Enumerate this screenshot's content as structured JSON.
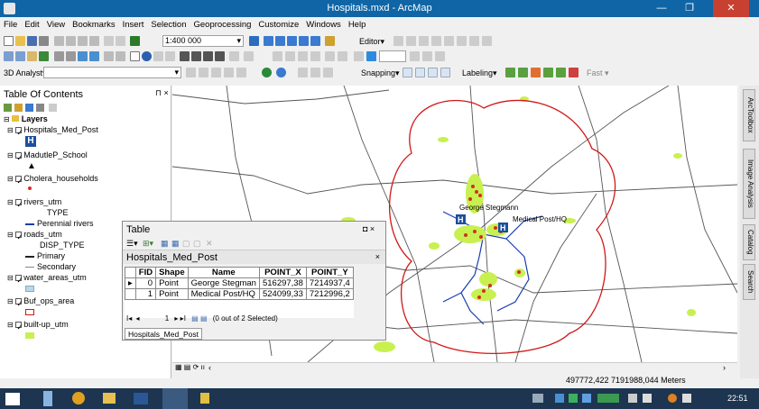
{
  "window": {
    "title": "Hospitals.mxd - ArcMap"
  },
  "menu": [
    "File",
    "Edit",
    "View",
    "Bookmarks",
    "Insert",
    "Selection",
    "Geoprocessing",
    "Customize",
    "Windows",
    "Help"
  ],
  "toolbar": {
    "scale": "1:400 000",
    "editor_label": "Editor",
    "analyst_label": "3D Analyst",
    "snapping_label": "Snapping",
    "labeling_label": "Labeling",
    "fast_label": "Fast"
  },
  "toc": {
    "title": "Table Of Contents",
    "layers_label": "Layers",
    "layers": [
      {
        "name": "Hospitals_Med_Post"
      },
      {
        "name": "MadutleP_School"
      },
      {
        "name": "Cholera_households"
      },
      {
        "name": "rivers_utm",
        "legend_title": "TYPE",
        "items": [
          "Perennial rivers"
        ]
      },
      {
        "name": "roads_utm",
        "legend_title": "DISP_TYPE",
        "items": [
          "Primary",
          "Secondary"
        ]
      },
      {
        "name": "water_areas_utm"
      },
      {
        "name": "Buf_ops_area"
      },
      {
        "name": "built-up_utm"
      }
    ]
  },
  "map": {
    "labels": [
      "George Stegmann",
      "Medical Post/HQ"
    ],
    "coords": "497772,422  7191988,044 Meters"
  },
  "right_dock": [
    "ArcToolbox",
    "Image Analysis",
    "Catalog",
    "Search"
  ],
  "table_window": {
    "title": "Table",
    "tab_title": "Hospitals_Med_Post",
    "columns": [
      "FID",
      "Shape",
      "Name",
      "POINT_X",
      "POINT_Y"
    ],
    "rows": [
      [
        "0",
        "Point",
        "George Stegman",
        "516297,38",
        "7214937,4"
      ],
      [
        "1",
        "Point",
        "Medical Post/HQ",
        "524099,33",
        "7212996,2"
      ]
    ],
    "record_number": "1",
    "selection_status": "(0 out of 2 Selected)",
    "bottom_tab": "Hospitals_Med_Post"
  },
  "taskbar": {
    "time": "22:51"
  },
  "colors": {
    "titlebar": "#0f65a6",
    "buffer": "#d01818",
    "builtup": "#c8f050",
    "river": "#1a3cb0",
    "taskbar": "#1d3550"
  }
}
